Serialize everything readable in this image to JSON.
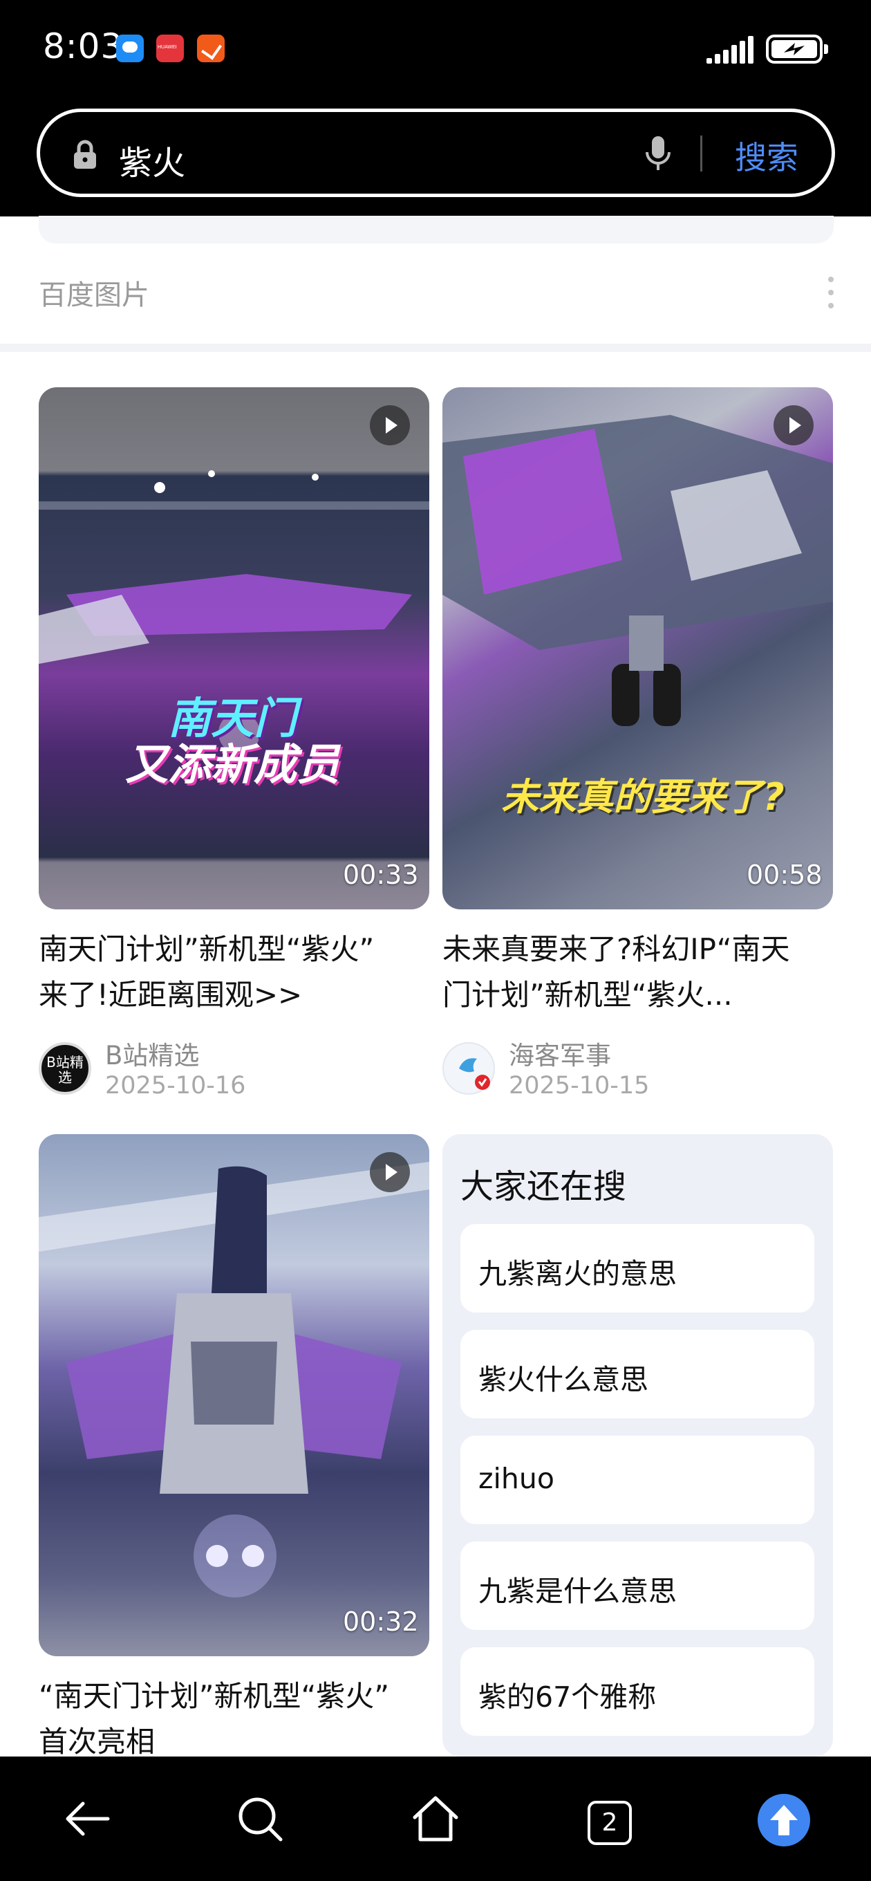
{
  "status_bar": {
    "time": "8:03",
    "notification_icons": [
      "message-app-icon",
      "huawei-app-icon",
      "orange-app-icon"
    ],
    "signal": "signal-strength-icon",
    "battery": "battery-charging-icon"
  },
  "search": {
    "query": "紫火",
    "button_label": "搜索",
    "accent": "#4f8cf7"
  },
  "source": {
    "label": "百度图片"
  },
  "videos": [
    {
      "title_line1": "南天门计划”新机型“紫火”",
      "title_line2": "来了!近距离围观>>",
      "duration": "00:33",
      "overlay_line1": "南天门",
      "overlay_line2": "又添新成员",
      "author": "B站精选",
      "avatar_text": "B站精选",
      "date": "2025-10-16"
    },
    {
      "title_line1": "未来真要来了?科幻IP“南天",
      "title_line2": "门计划”新机型“紫火...",
      "duration": "00:58",
      "overlay_line1": "未来真的要来了?",
      "author": "海客军事",
      "date": "2025-10-15"
    },
    {
      "title_line1": "“南天门计划”新机型“紫火”",
      "title_line2": "首次亮相",
      "duration": "00:32"
    }
  ],
  "related": {
    "title": "大家还在搜",
    "items": [
      "九紫离火的意思",
      "紫火什么意思",
      "zihuo",
      "九紫是什么意思",
      "紫的67个雅称"
    ]
  },
  "bottom_nav": {
    "tab_count": "2",
    "accent": "#3f86f2"
  }
}
